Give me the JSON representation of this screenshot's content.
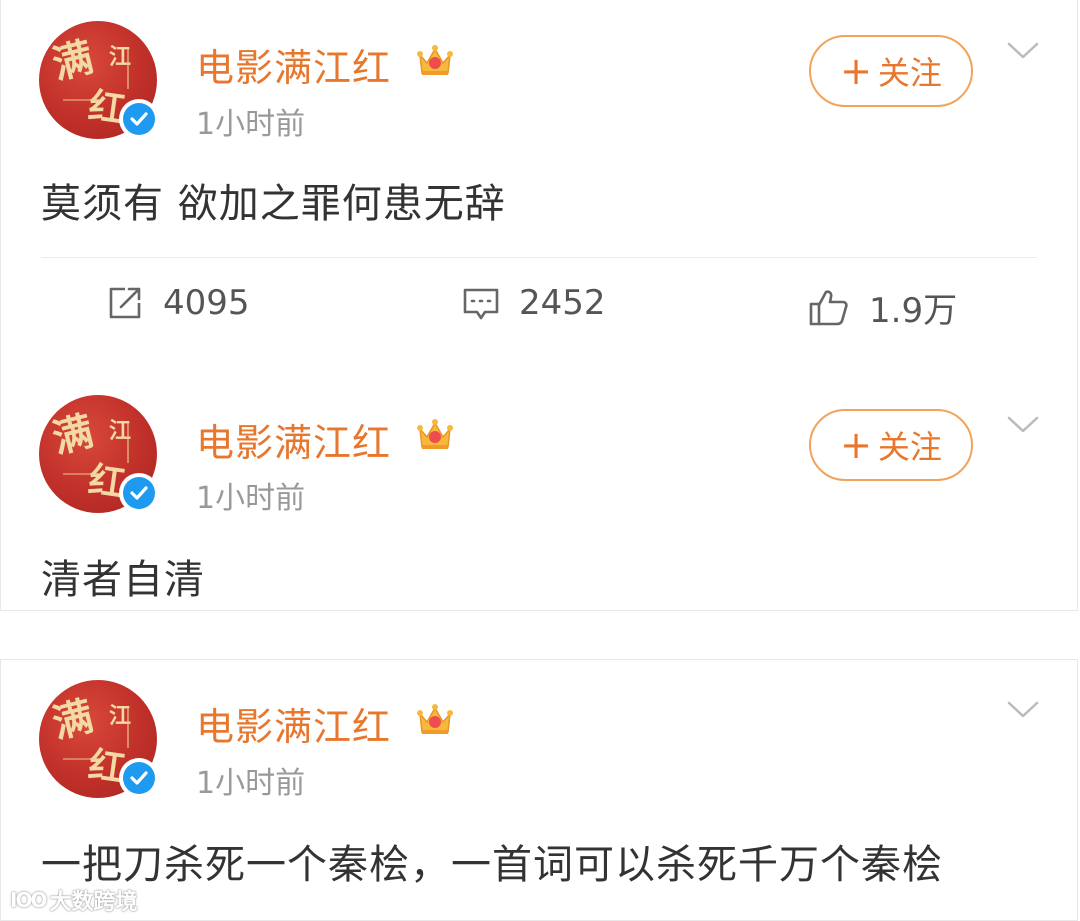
{
  "posts": [
    {
      "account_name": "电影满江红",
      "time": "1小时前",
      "follow_label": "关注",
      "follow_plus": "+",
      "content": "莫须有 欲加之罪何患无辞",
      "actions": {
        "repost_count": "4095",
        "comment_count": "2452",
        "like_count": "1.9万"
      }
    },
    {
      "account_name": "电影满江红",
      "time": "1小时前",
      "follow_label": "关注",
      "follow_plus": "+",
      "content": "清者自清"
    },
    {
      "account_name": "电影满江红",
      "time": "1小时前",
      "content": "一把刀杀死一个秦桧，一首词可以杀死千万个秦桧"
    }
  ],
  "watermark": {
    "logo_text": "IOO",
    "text": "大数跨境"
  },
  "icons": {
    "verified": "verified-icon",
    "vip_crown": "crown-icon",
    "more": "chevron-down-icon",
    "repost": "repost-icon",
    "comment": "comment-icon",
    "like": "thumbs-up-icon"
  },
  "colors": {
    "accent_orange": "#e8772e",
    "verified_blue": "#1e9bf0",
    "avatar_red": "#c0302a"
  }
}
